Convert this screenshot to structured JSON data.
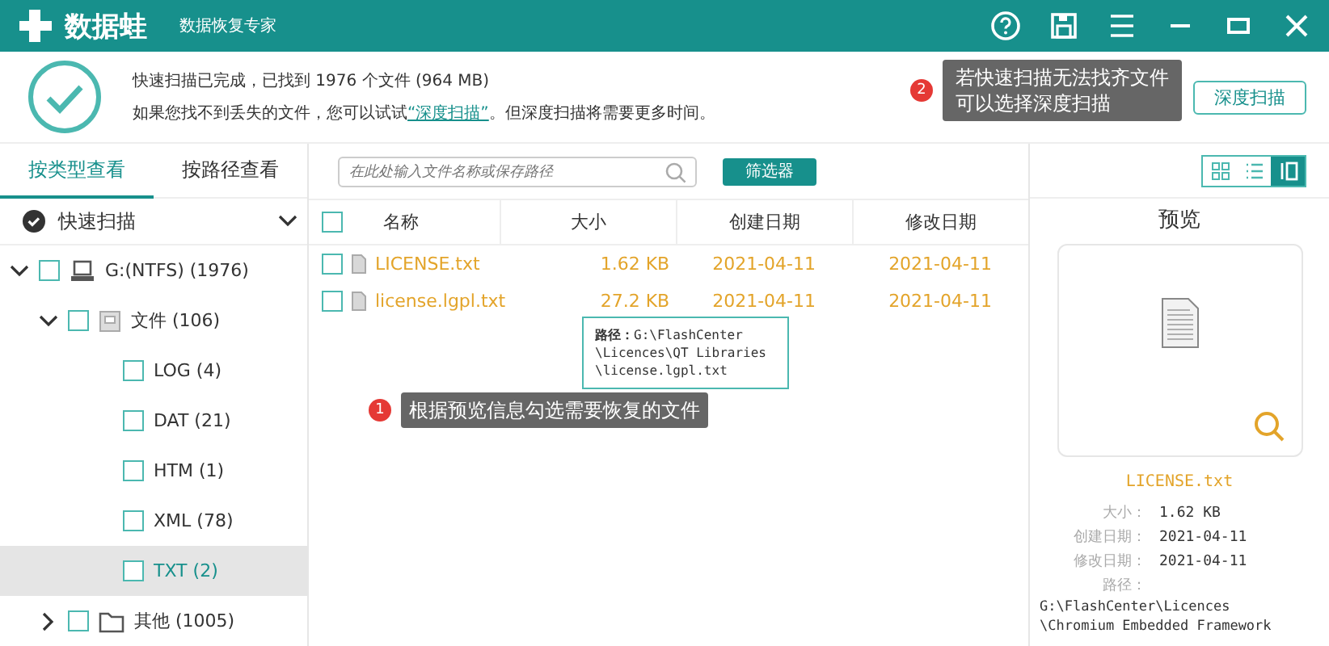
{
  "titlebar": {
    "logo": "数据蛙",
    "subtitle": "数据恢复专家"
  },
  "summary": {
    "line1": "快速扫描已完成，已找到 1976 个文件 (964 MB)",
    "line2_before": "如果您找不到丢失的文件，您可以试试",
    "line2_link": "“深度扫描”",
    "line2_after": "。但深度扫描将需要更多时间。",
    "button": "深度扫描"
  },
  "callouts": [
    {
      "number": "2",
      "lines": [
        "若快速扫描无法找齐文件",
        "可以选择深度扫描"
      ]
    },
    {
      "number": "1",
      "lines": [
        "根据预览信息勾选需要恢复的文件"
      ]
    }
  ],
  "sidebar": {
    "tabs": [
      {
        "label": "按类型查看",
        "selected": true
      },
      {
        "label": "按路径查看",
        "selected": false
      }
    ],
    "scan_mode": "快速扫描",
    "tree": [
      {
        "label": "G:(NTFS) (1976)",
        "kind": "drive",
        "expanded": true,
        "checked": false,
        "selected": false,
        "children": [
          {
            "label": "文件 (106)",
            "kind": "file",
            "expanded": true,
            "checked": false,
            "selected": false,
            "children": [
              {
                "label": "LOG (4)",
                "checked": false,
                "selected": false
              },
              {
                "label": "DAT (21)",
                "checked": false,
                "selected": false
              },
              {
                "label": "HTM (1)",
                "checked": false,
                "selected": false
              },
              {
                "label": "XML (78)",
                "checked": false,
                "selected": false
              },
              {
                "label": "TXT (2)",
                "checked": false,
                "selected": true
              }
            ]
          },
          {
            "label": "其他 (1005)",
            "kind": "folder",
            "expanded": false,
            "checked": false,
            "selected": false
          }
        ]
      }
    ]
  },
  "toolbar": {
    "search": {
      "placeholder": "在此处输入文件名称或保存路径"
    },
    "filter_button": "筛选器",
    "views": [
      {
        "kind": "grid",
        "selected": false
      },
      {
        "kind": "list",
        "selected": false
      },
      {
        "kind": "detail",
        "selected": true
      }
    ]
  },
  "table": {
    "columns": [
      "名称",
      "大小",
      "创建日期",
      "修改日期"
    ],
    "all_checked": false,
    "rows": [
      {
        "name": "LICENSE.txt",
        "size": "1.62 KB",
        "created": "2021-04-11",
        "modified": "2021-04-11",
        "checked": false
      },
      {
        "name": "license.lgpl.txt",
        "size": "27.2 KB",
        "created": "2021-04-11",
        "modified": "2021-04-11",
        "checked": false
      }
    ]
  },
  "tooltip": {
    "label": "路径：",
    "lines": [
      "G:\\FlashCenter",
      "\\Licences\\QT Libraries",
      "\\license.lgpl.txt"
    ]
  },
  "preview": {
    "title": "预览",
    "filename": "LICENSE.txt",
    "details": [
      {
        "label": "大小：",
        "value": "1.62 KB"
      },
      {
        "label": "创建日期：",
        "value": "2021-04-11"
      },
      {
        "label": "修改日期：",
        "value": "2021-04-11"
      }
    ],
    "path_label": "路径：",
    "path_lines": [
      "G:\\FlashCenter\\Licences",
      "\\Chromium Embedded Framework"
    ]
  }
}
